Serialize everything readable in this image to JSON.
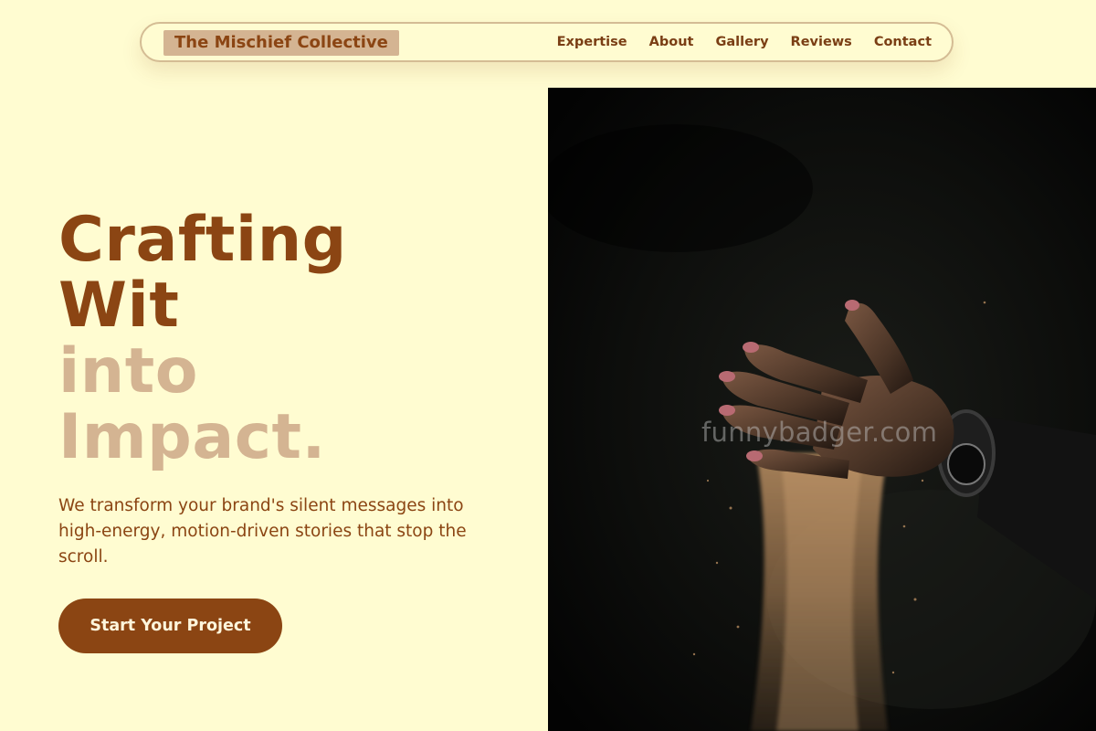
{
  "brand": {
    "name": "The Mischief Collective"
  },
  "nav": {
    "links": [
      "Expertise",
      "About",
      "Gallery",
      "Reviews",
      "Contact"
    ]
  },
  "hero": {
    "title_lines": [
      "Crafting",
      "Wit",
      "into",
      "Impact."
    ],
    "subtitle": "We transform your brand's silent messages into high-energy, motion-driven stories that stop the scroll.",
    "cta_label": "Start Your Project"
  },
  "image": {
    "subject": "hand-pouring-sand-photo",
    "watermark": "funnybadger.com"
  },
  "colors": {
    "background": "#FFFCD1",
    "primary": "#8B4513",
    "accent_light": "#D4B492",
    "cta_text": "#FFF6DC"
  }
}
